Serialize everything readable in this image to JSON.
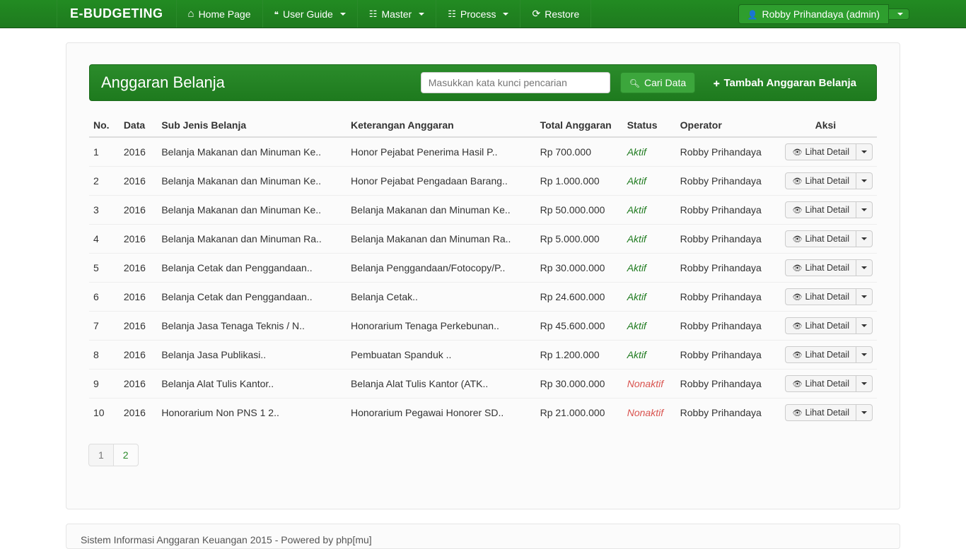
{
  "brand": "E-BUDGETING",
  "nav": {
    "home": "Home Page",
    "userguide": "User Guide",
    "master": "Master",
    "process": "Process",
    "restore": "Restore"
  },
  "user": {
    "label": "Robby Prihandaya (admin)"
  },
  "headerbar": {
    "title": "Anggaran Belanja",
    "search_placeholder": "Masukkan kata kunci pencarian",
    "search_btn": "Cari Data",
    "add_btn": "Tambah Anggaran Belanja"
  },
  "columns": {
    "no": "No.",
    "data": "Data",
    "subjenis": "Sub Jenis Belanja",
    "keterangan": "Keterangan Anggaran",
    "total": "Total Anggaran",
    "status": "Status",
    "operator": "Operator",
    "aksi": "Aksi"
  },
  "detail_label": "Lihat Detail",
  "rows": [
    {
      "no": "1",
      "data": "2016",
      "subjenis": "Belanja Makanan dan Minuman Ke..",
      "keterangan": "Honor Pejabat Penerima Hasil P..",
      "total": "Rp 700.000",
      "status": "Aktif",
      "operator": "Robby Prihandaya"
    },
    {
      "no": "2",
      "data": "2016",
      "subjenis": "Belanja Makanan dan Minuman Ke..",
      "keterangan": "Honor Pejabat Pengadaan Barang..",
      "total": "Rp 1.000.000",
      "status": "Aktif",
      "operator": "Robby Prihandaya"
    },
    {
      "no": "3",
      "data": "2016",
      "subjenis": "Belanja Makanan dan Minuman Ke..",
      "keterangan": "Belanja Makanan dan Minuman Ke..",
      "total": "Rp 50.000.000",
      "status": "Aktif",
      "operator": "Robby Prihandaya"
    },
    {
      "no": "4",
      "data": "2016",
      "subjenis": "Belanja Makanan dan Minuman Ra..",
      "keterangan": "Belanja Makanan dan Minuman Ra..",
      "total": "Rp 5.000.000",
      "status": "Aktif",
      "operator": "Robby Prihandaya"
    },
    {
      "no": "5",
      "data": "2016",
      "subjenis": "Belanja Cetak dan Penggandaan..",
      "keterangan": "Belanja Penggandaan/Fotocopy/P..",
      "total": "Rp 30.000.000",
      "status": "Aktif",
      "operator": "Robby Prihandaya"
    },
    {
      "no": "6",
      "data": "2016",
      "subjenis": "Belanja Cetak dan Penggandaan..",
      "keterangan": "Belanja Cetak..",
      "total": "Rp 24.600.000",
      "status": "Aktif",
      "operator": "Robby Prihandaya"
    },
    {
      "no": "7",
      "data": "2016",
      "subjenis": "Belanja Jasa Tenaga Teknis / N..",
      "keterangan": "Honorarium Tenaga Perkebunan..",
      "total": "Rp 45.600.000",
      "status": "Aktif",
      "operator": "Robby Prihandaya"
    },
    {
      "no": "8",
      "data": "2016",
      "subjenis": "Belanja Jasa Publikasi..",
      "keterangan": "Pembuatan Spanduk ..",
      "total": "Rp 1.200.000",
      "status": "Aktif",
      "operator": "Robby Prihandaya"
    },
    {
      "no": "9",
      "data": "2016",
      "subjenis": "Belanja Alat Tulis Kantor..",
      "keterangan": "Belanja Alat Tulis Kantor (ATK..",
      "total": "Rp 30.000.000",
      "status": "Nonaktif",
      "operator": "Robby Prihandaya"
    },
    {
      "no": "10",
      "data": "2016",
      "subjenis": "Honorarium Non PNS 1 2..",
      "keterangan": "Honorarium Pegawai Honorer SD..",
      "total": "Rp 21.000.000",
      "status": "Nonaktif",
      "operator": "Robby Prihandaya"
    }
  ],
  "pagination": {
    "p1": "1",
    "p2": "2"
  },
  "footer": "Sistem Informasi Anggaran Keuangan 2015 - Powered by php[mu]"
}
